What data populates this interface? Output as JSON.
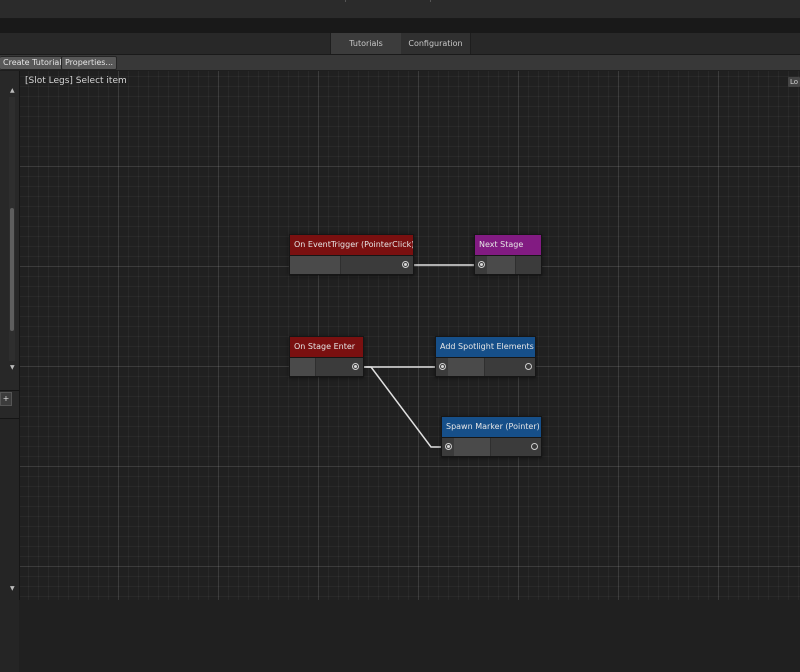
{
  "tabs": [
    {
      "label": "Tutorials",
      "active": true
    },
    {
      "label": "Configuration",
      "active": false
    }
  ],
  "toolbar": {
    "create_label": "Create Tutorial",
    "properties_label": "Properties..."
  },
  "canvas": {
    "title": "[Slot Legs] Select item",
    "corner_label": "Lo"
  },
  "nodes": {
    "event_trigger": {
      "title": "On EventTrigger (PointerClick)",
      "color": "#7a1010"
    },
    "next_stage": {
      "title": "Next Stage",
      "color": "#821b82"
    },
    "stage_enter": {
      "title": "On Stage Enter",
      "color": "#7a1010"
    },
    "spotlight": {
      "title": "Add Spotlight Elements",
      "color": "#164f89"
    },
    "spawn_marker": {
      "title": "Spawn Marker (Pointer)",
      "color": "#164f89"
    }
  },
  "colors": {
    "background": "#202020",
    "event_node": "#7a1010",
    "stage_node": "#821b82",
    "action_node": "#164f89",
    "wire": "#e0e0e0"
  },
  "icons": {
    "sidebar_scroll_up": "triangle-up",
    "sidebar_scroll_down": "triangle-down",
    "sidebar_add": "plus"
  }
}
